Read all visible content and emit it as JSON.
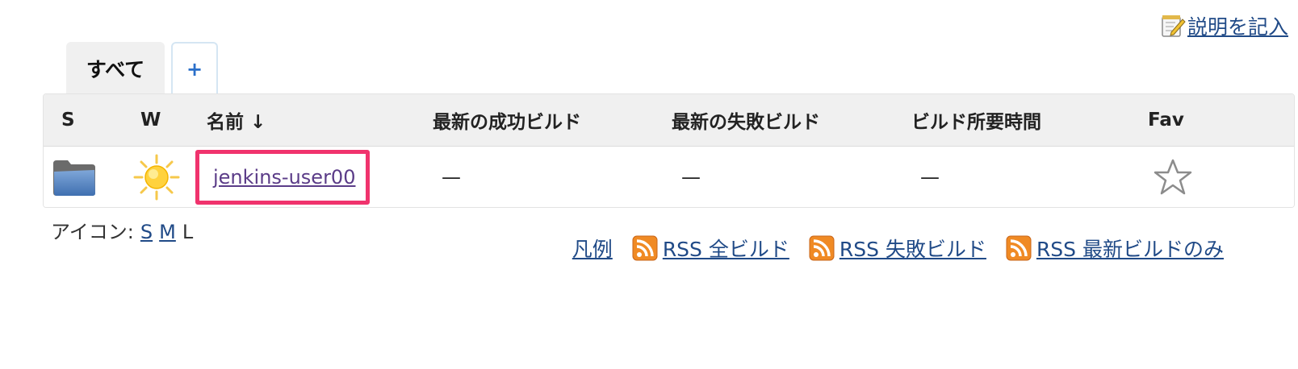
{
  "header": {
    "description_link": "説明を記入"
  },
  "tabs": [
    {
      "label": "すべて",
      "active": true
    },
    {
      "label": "+",
      "active": false
    }
  ],
  "table": {
    "columns": {
      "status": "S",
      "weather": "W",
      "name": "名前 ↓",
      "last_success": "最新の成功ビルド",
      "last_failure": "最新の失敗ビルド",
      "last_duration": "ビルド所要時間",
      "fav": "Fav"
    },
    "rows": [
      {
        "status_icon": "folder-icon",
        "weather_icon": "sun-icon",
        "name": "jenkins-user00",
        "last_success": "—",
        "last_failure": "—",
        "last_duration": "—",
        "fav_icon": "star-outline-icon"
      }
    ]
  },
  "icon_size": {
    "label": "アイコン:",
    "options": [
      "S",
      "M",
      "L"
    ],
    "selected": "L"
  },
  "footer": {
    "legend": "凡例",
    "rss_all": "RSS 全ビルド",
    "rss_failed": "RSS 失敗ビルド",
    "rss_latest": "RSS 最新ビルドのみ"
  },
  "colors": {
    "link": "#204a87",
    "highlight_border": "#f0336d",
    "visited_link": "#5b3c88",
    "header_bg": "#f0f0f0"
  }
}
